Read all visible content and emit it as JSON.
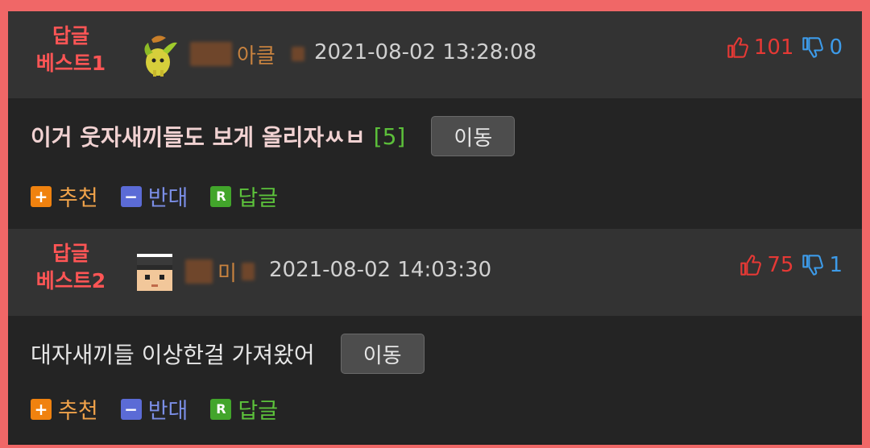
{
  "comments": [
    {
      "best_label_line1": "답글",
      "best_label_line2": "베스트1",
      "nickname_visible": "아클",
      "date": "2021-08-02 13:28:08",
      "up_count": "101",
      "down_count": "0",
      "text": "이거 웃자새끼들도 보게 올리자ㅆㅂ",
      "reply_count": "[5]",
      "move_label": "이동",
      "actions": {
        "recommend": "추천",
        "oppose": "반대",
        "reply": "답글"
      },
      "avatar_icon": "leaf-character-icon"
    },
    {
      "best_label_line1": "답글",
      "best_label_line2": "베스트2",
      "nickname_visible": "미",
      "date": "2021-08-02 14:03:30",
      "up_count": "75",
      "down_count": "1",
      "text": "대자새끼들 이상한걸 가져왔어",
      "move_label": "이동",
      "actions": {
        "recommend": "추천",
        "oppose": "반대",
        "reply": "답글"
      },
      "avatar_icon": "pixel-face-icon"
    }
  ],
  "colors": {
    "border": "#f06767",
    "best_label": "#ff5555",
    "up": "#e53935",
    "down": "#3d9be9",
    "recommend": "#f0820f",
    "oppose": "#5b6bd6",
    "reply": "#42a52b"
  },
  "action_glyphs": {
    "recommend": "+",
    "oppose": "−",
    "reply": "R"
  }
}
